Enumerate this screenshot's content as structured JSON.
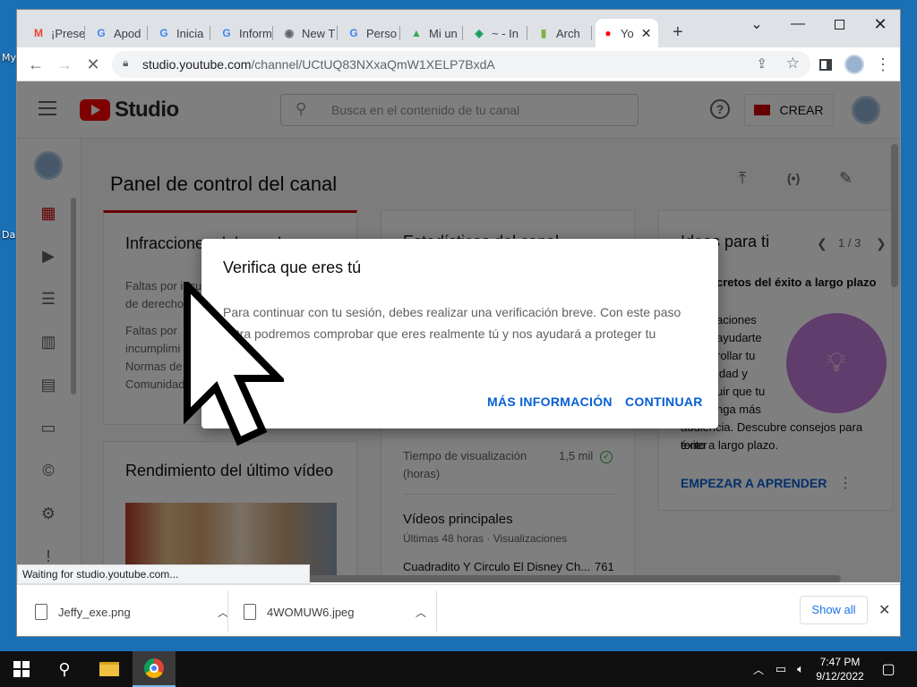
{
  "desktop": {
    "label_my": "My",
    "label_da": "Da"
  },
  "browser": {
    "tabs": [
      {
        "label": "¡Prese",
        "icon": "gmail-icon"
      },
      {
        "label": "Apod",
        "icon": "google-icon"
      },
      {
        "label": "Inicia",
        "icon": "google-icon"
      },
      {
        "label": "Inform",
        "icon": "google-icon"
      },
      {
        "label": "New T",
        "icon": "chrome-icon"
      },
      {
        "label": "Perso",
        "icon": "google-icon"
      },
      {
        "label": "Mi un",
        "icon": "drive-icon"
      },
      {
        "label": "~ - In",
        "icon": "app-icon"
      },
      {
        "label": "Arch",
        "icon": "book-icon"
      },
      {
        "label": "Yo",
        "icon": "youtube-studio-icon"
      }
    ],
    "new_tab": "+",
    "url_main": "studio.youtube.com",
    "url_rest": "/channel/UCtUQ83NXxaQmW1XELP7BxdA"
  },
  "studio": {
    "logo_text": "Studio",
    "search_placeholder": "Busca en el contenido de tu canal",
    "create_label": "CREAR",
    "page_title": "Panel de control del canal",
    "card1": {
      "title": "Infracciones del canal",
      "line1": "Faltas por incu",
      "line2": "de derechos",
      "line3": "Faltas por",
      "line4": "incumplimi",
      "line5": "Normas de",
      "line6": "Comunidad"
    },
    "card2": {
      "title": "Estadísticas del canal",
      "metric_label_1": "Tiempo de visualización",
      "metric_label_2": "(horas)",
      "metric_value": "1,5 mil",
      "section_title": "Vídeos principales",
      "section_sub": "Últimas 48 horas · Visualizaciones",
      "video_title": "Cuadradito Y Circulo El Disney Ch...",
      "video_views": "761"
    },
    "card3": {
      "title": "Ideas para ti",
      "pager": "1 / 3",
      "subtitle": "cretos del éxito a largo plazo",
      "lines": [
        "aciones",
        "ayudarte",
        "rollar tu",
        "idad y",
        "uir que tu",
        "nga más",
        "audiencia. Descubre consejos para tener",
        "éxito a largo plazo."
      ],
      "action": "EMPEZAR A APRENDER"
    },
    "card4": {
      "title": "Rendimiento del último vídeo"
    }
  },
  "dialog": {
    "title": "Verifica que eres tú",
    "body": "Para continuar con tu sesión, debes realizar una verificación breve. Con este paso extra podremos comprobar que eres realmente tú y nos ayudará a proteger tu cuenta.",
    "more_info": "MÁS INFORMACIÓN",
    "continue": "CONTINUAR"
  },
  "status_text": "Waiting for studio.youtube.com...",
  "downloads": {
    "items": [
      {
        "name": "Jeffy_exe.png"
      },
      {
        "name": "4WOMUW6.jpeg"
      }
    ],
    "show_all": "Show all"
  },
  "taskbar": {
    "time": "7:47 PM",
    "date": "9/12/2022"
  }
}
